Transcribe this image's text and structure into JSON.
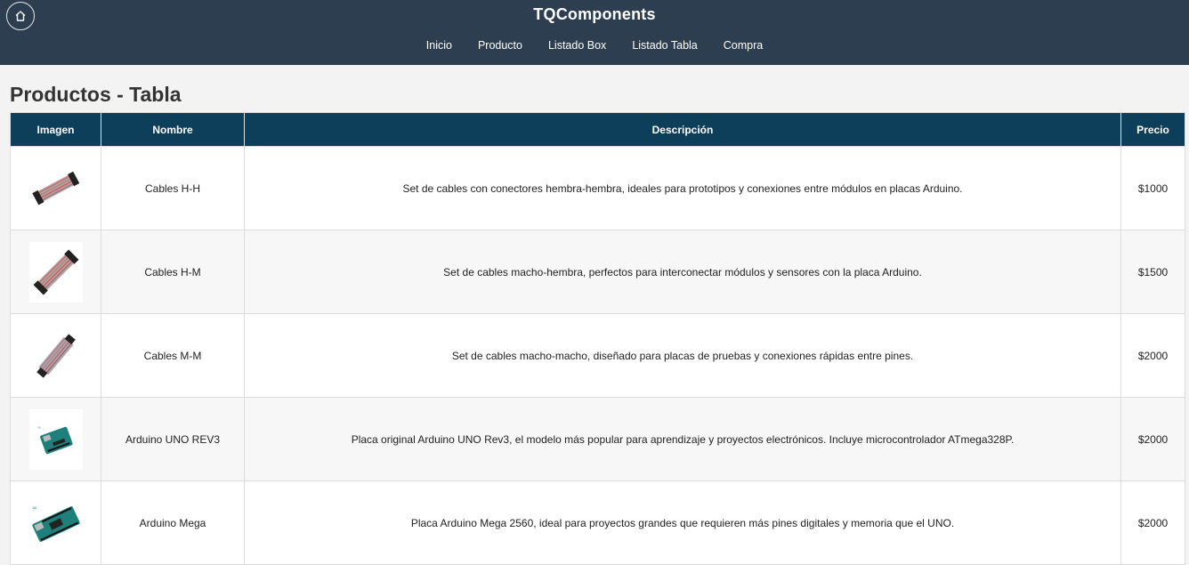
{
  "header": {
    "brand": "TQComponents",
    "nav": [
      "Inicio",
      "Producto",
      "Listado Box",
      "Listado Tabla",
      "Compra"
    ]
  },
  "page_title": "Productos - Tabla",
  "table": {
    "columns": [
      "Imagen",
      "Nombre",
      "Descripción",
      "Precio"
    ],
    "rows": [
      {
        "name": "Cables H-H",
        "description": "Set de cables con conectores hembra-hembra, ideales para prototipos y conexiones entre módulos en placas Arduino.",
        "price": "$1000",
        "image": "jumper-cables-icon"
      },
      {
        "name": "Cables H-M",
        "description": "Set de cables macho-hembra, perfectos para interconectar módulos y sensores con la placa Arduino.",
        "price": "$1500",
        "image": "jumper-cables-icon"
      },
      {
        "name": "Cables M-M",
        "description": "Set de cables macho-macho, diseñado para placas de pruebas y conexiones rápidas entre pines.",
        "price": "$2000",
        "image": "jumper-cables-icon"
      },
      {
        "name": "Arduino UNO REV3",
        "description": "Placa original Arduino UNO Rev3, el modelo más popular para aprendizaje y proyectos electrónicos. Incluye microcontrolador ATmega328P.",
        "price": "$2000",
        "image": "arduino-board-icon"
      },
      {
        "name": "Arduino Mega",
        "description": "Placa Arduino Mega 2560, ideal para proyectos grandes que requieren más pines digitales y memoria que el UNO.",
        "price": "$2000",
        "image": "arduino-board-icon"
      }
    ]
  },
  "colors": {
    "header_bg": "#2c3e50",
    "table_header_bg": "#0e3f5a",
    "page_bg": "#f3f3f3"
  }
}
